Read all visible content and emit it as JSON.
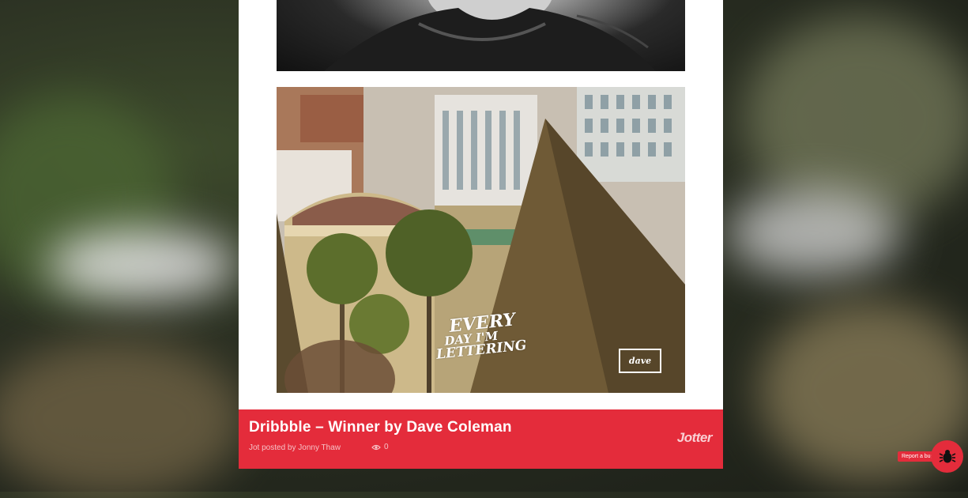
{
  "post": {
    "title": "Dribbble – Winner by Dave Coleman",
    "posted_by": "Jot posted by Jonny Thaw",
    "views": "0",
    "brand": "Jotter"
  },
  "artwork": {
    "lettering_line1": "EVERY",
    "lettering_line2": "DAY I'M",
    "lettering_line3": "LETTERING",
    "signature": "dave"
  },
  "bug_report": {
    "label": "Report a bug"
  },
  "colors": {
    "accent": "#e42c3b",
    "card": "#ffffff"
  }
}
